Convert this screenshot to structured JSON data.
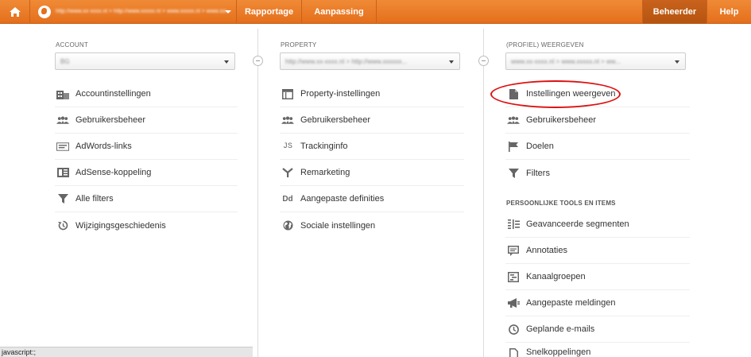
{
  "topbar": {
    "account_text": "http://www.xx-xxxx.nl > http://www.xxxxx.nl > www.xxxxx.nl > www.xxxxxx.nl",
    "tabs": {
      "reporting": "Rapportage",
      "customization": "Aanpassing",
      "admin": "Beheerder",
      "help": "Help"
    }
  },
  "columns": {
    "account": {
      "label": "ACCOUNT",
      "select_value": "BG",
      "items": [
        "Accountinstellingen",
        "Gebruikersbeheer",
        "AdWords-links",
        "AdSense-koppeling",
        "Alle filters",
        "Wijzigingsgeschiedenis"
      ]
    },
    "property": {
      "label": "PROPERTY",
      "select_value": "http://www.xx-xxxx.nl > http://www.xxxxxx...",
      "items": [
        "Property-instellingen",
        "Gebruikersbeheer",
        "Trackinginfo",
        "Remarketing",
        "Aangepaste definities",
        "Sociale instellingen"
      ],
      "definitions_icon_text": "Dd",
      "tracking_icon_text": "JS"
    },
    "view": {
      "label": "(PROFIEL) WEERGEVEN",
      "select_value": "www.xx-xxxx.nl > www.xxxxx.nl > ww...",
      "items": [
        "Instellingen weergeven",
        "Gebruikersbeheer",
        "Doelen",
        "Filters"
      ],
      "personal_heading": "PERSOONLIJKE TOOLS EN ITEMS",
      "personal_items": [
        "Geavanceerde segmenten",
        "Annotaties",
        "Kanaalgroepen",
        "Aangepaste meldingen",
        "Geplande e-mails",
        "Snelkoppelingen"
      ]
    }
  },
  "status_bar": "javascript:;",
  "colors": {
    "accent": "#e46f1c",
    "highlight_oval": "#dd1111"
  }
}
